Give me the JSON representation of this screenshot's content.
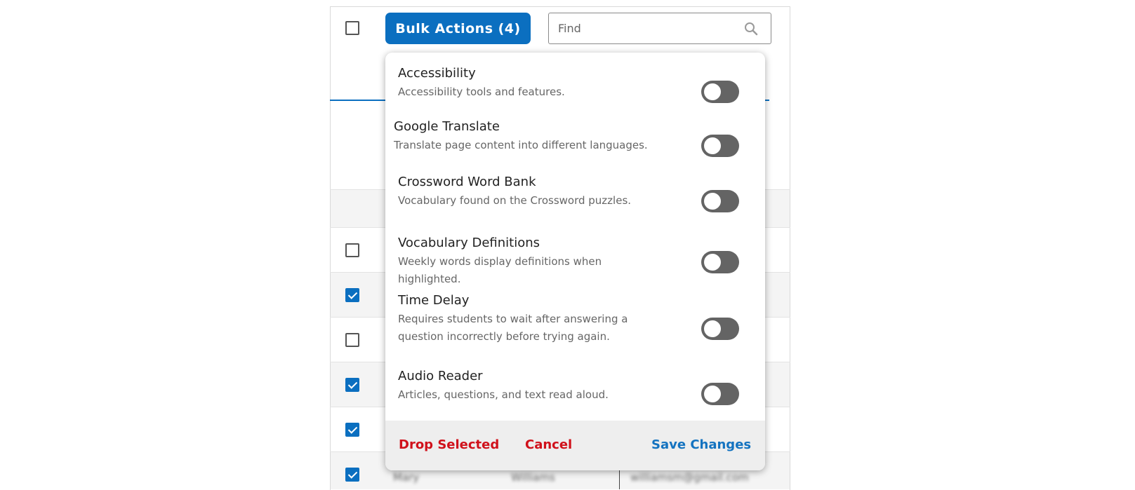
{
  "toolbar": {
    "bulk_actions_label": "Bulk Actions (4)",
    "find_placeholder": "Find"
  },
  "rows": [
    {
      "checked": false
    },
    {
      "checked": true
    },
    {
      "checked": false
    },
    {
      "checked": true
    },
    {
      "checked": true
    },
    {
      "checked": true,
      "first_name": "Mary",
      "last_name": "Williams",
      "email": "williamsm@gmail.com"
    }
  ],
  "popup": {
    "options": [
      {
        "title": "Accessibility",
        "description": "Accessibility tools and features.",
        "enabled": false
      },
      {
        "title": "Google Translate",
        "description": "Translate page content into different languages.",
        "enabled": false
      },
      {
        "title": "Crossword Word Bank",
        "description": "Vocabulary found on the Crossword puzzles.",
        "enabled": false
      },
      {
        "title": "Vocabulary Definitions",
        "description": "Weekly words display definitions when highlighted.",
        "enabled": false
      },
      {
        "title": "Time Delay",
        "description": "Requires students to wait after answering a question incorrectly before trying again.",
        "enabled": false
      },
      {
        "title": "Audio Reader",
        "description": "Articles, questions, and text read aloud.",
        "enabled": false
      }
    ],
    "footer": {
      "drop_selected_label": "Drop Selected",
      "cancel_label": "Cancel",
      "save_changes_label": "Save Changes"
    }
  },
  "colors": {
    "primary": "#0b6fc0",
    "danger": "#d0111b",
    "toggle_off": "#646464"
  }
}
